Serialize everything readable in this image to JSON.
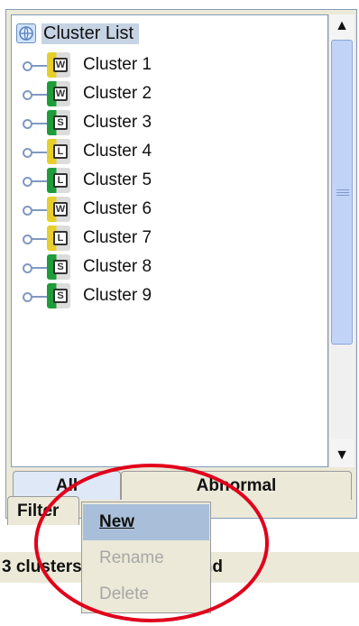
{
  "tree": {
    "root_label": "Cluster List",
    "nodes": [
      {
        "label": "Cluster 1",
        "type_letter": "W",
        "badge": "W",
        "bar_color": "#e6cf2a"
      },
      {
        "label": "Cluster 2",
        "type_letter": "W",
        "badge": "W",
        "bar_color": "#1f9c3a"
      },
      {
        "label": "Cluster 3",
        "type_letter": "S",
        "badge": "S",
        "bar_color": "#1f9c3a"
      },
      {
        "label": "Cluster 4",
        "type_letter": "L",
        "badge": "L",
        "bar_color": "#e6cf2a"
      },
      {
        "label": "Cluster 5",
        "type_letter": "L",
        "badge": "L",
        "bar_color": "#1f9c3a"
      },
      {
        "label": "Cluster 6",
        "type_letter": "W",
        "badge": "W",
        "bar_color": "#e6cf2a"
      },
      {
        "label": "Cluster 7",
        "type_letter": "L",
        "badge": "L",
        "bar_color": "#e6cf2a"
      },
      {
        "label": "Cluster 8",
        "type_letter": "S",
        "badge": "S",
        "bar_color": "#1f9c3a"
      },
      {
        "label": "Cluster 9",
        "type_letter": "S",
        "badge": "S",
        "bar_color": "#1f9c3a"
      }
    ]
  },
  "tabs": {
    "all_label": "All",
    "abnormal_label": "Abnormal",
    "filter_label": "Filter"
  },
  "context_menu": {
    "items": [
      {
        "label": "New",
        "enabled": true
      },
      {
        "label": "Rename",
        "enabled": false
      },
      {
        "label": "Delete",
        "enabled": false
      }
    ]
  },
  "status_bar": {
    "text": "3 clusters have been found"
  },
  "icons": {
    "root": "globe-icon",
    "scroll_up": "scroll-up-arrow-icon",
    "scroll_down": "scroll-down-arrow-icon",
    "node_connector": "tree-connector-icon"
  },
  "colors": {
    "highlight_ellipse": "#e0001b",
    "selection": "#a9bfd9"
  }
}
